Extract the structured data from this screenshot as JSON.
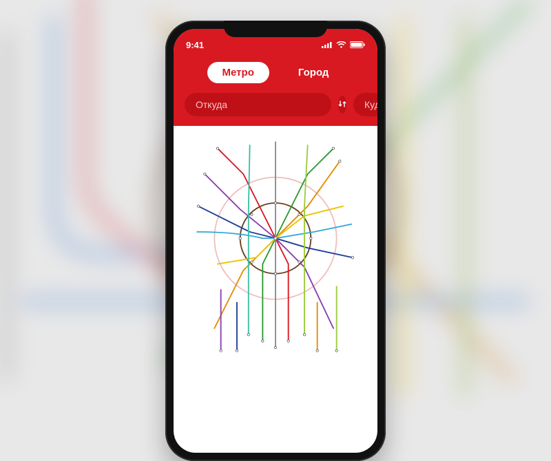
{
  "status": {
    "time": "9:41"
  },
  "tabs": {
    "metro": "Метро",
    "city": "Город",
    "active": "metro"
  },
  "search": {
    "from_placeholder": "Откуда",
    "to_placeholder": "Куда"
  },
  "colors": {
    "brand": "#d81921"
  }
}
